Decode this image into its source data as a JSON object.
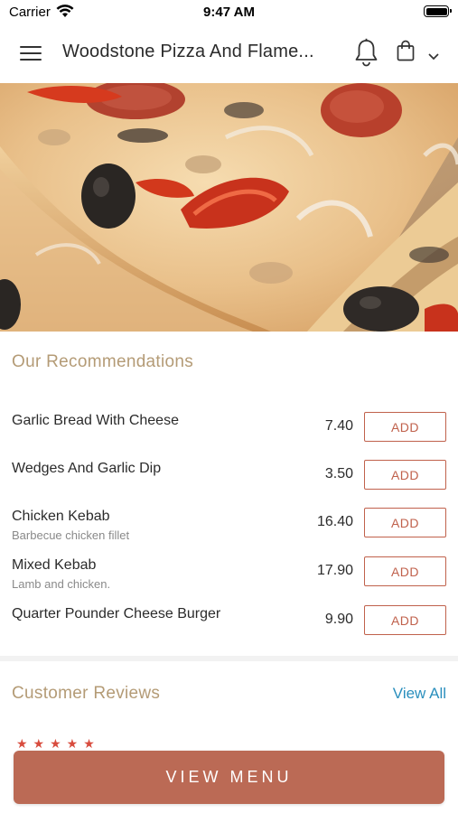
{
  "status_bar": {
    "carrier": "Carrier",
    "time": "9:47 AM"
  },
  "header": {
    "title": "Woodstone Pizza And Flame...",
    "icons": [
      "menu-icon",
      "bell-icon",
      "shopping-bag-icon",
      "chevron-down-icon"
    ]
  },
  "hero": {
    "image": "pizza-photo"
  },
  "recommendations": {
    "title": "Our Recommendations",
    "add_label": "ADD",
    "items": [
      {
        "name": "Garlic Bread With Cheese",
        "description": "",
        "price": "7.40"
      },
      {
        "name": "Wedges And Garlic Dip",
        "description": "",
        "price": "3.50"
      },
      {
        "name": "Chicken Kebab",
        "description": "Barbecue chicken fillet",
        "price": "16.40"
      },
      {
        "name": "Mixed Kebab",
        "description": "Lamb and chicken.",
        "price": "17.90"
      },
      {
        "name": "Quarter Pounder Cheese Burger",
        "description": "",
        "price": "9.90"
      }
    ]
  },
  "reviews": {
    "title": "Customer Reviews",
    "view_all": "View All"
  },
  "footer": {
    "view_menu": "VIEW MENU"
  },
  "colors": {
    "accent": "#bb6a55",
    "add_border": "#c0614c",
    "section_title": "#b49b76",
    "link": "#2a8fbd"
  }
}
